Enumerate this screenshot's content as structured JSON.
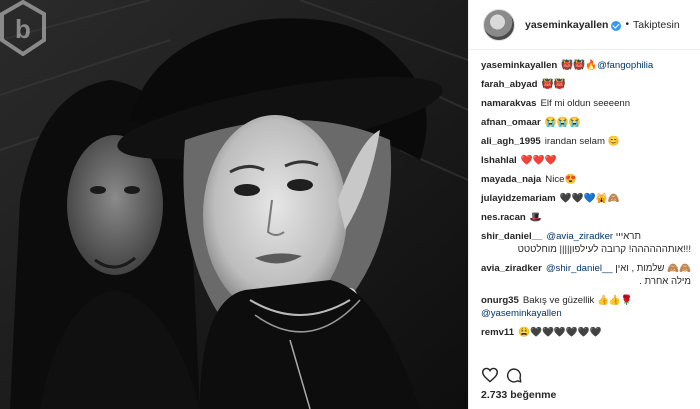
{
  "post": {
    "username": "yaseminkayallen",
    "follow_label": "Takiptesin",
    "dot": "•",
    "likes_label": "2.733 beğenme"
  },
  "comments": [
    {
      "user": "yaseminkayallen",
      "text": "👹👹🔥",
      "mention": "@fangophilia"
    },
    {
      "user": "farah_abyad",
      "text": "👹👹"
    },
    {
      "user": "namarakvas",
      "text": "Elf mi oldun seeeenn"
    },
    {
      "user": "afnan_omaar",
      "text": "😭😭😭"
    },
    {
      "user": "ali_agh_1995",
      "text": "irandan selam 😊"
    },
    {
      "user": "lshahlal",
      "text": "❤️❤️❤️"
    },
    {
      "user": "mayada_naja",
      "text": "Nice😍"
    },
    {
      "user": "julayidzemariam",
      "text": "🖤🖤💙🙀🙈"
    },
    {
      "user": "nes.racan",
      "text": "🎩"
    },
    {
      "user": "shir_daniel__",
      "mention": "@avia_ziradker",
      "text": "תראייי",
      "text2": "!!!אותהההההה! קרובה לעילפון|||| מוחלטטט"
    },
    {
      "user": "avia_ziradker",
      "mention": "@shir_daniel__",
      "text": "שלמות , ואין 🙈🙈",
      "text2": "מילה אחרת ."
    },
    {
      "user": "onurg35",
      "text": "Bakış ve güzellik 👍👍🌹",
      "mention2": "@yaseminkayallen"
    },
    {
      "user": "remv11",
      "text": "😩🖤🖤🖤🖤🖤🖤"
    }
  ],
  "icons": {
    "heart": "heart-icon",
    "comment": "comment-icon",
    "verified": "verified-badge-icon",
    "watermark": "b-watermark-logo"
  }
}
